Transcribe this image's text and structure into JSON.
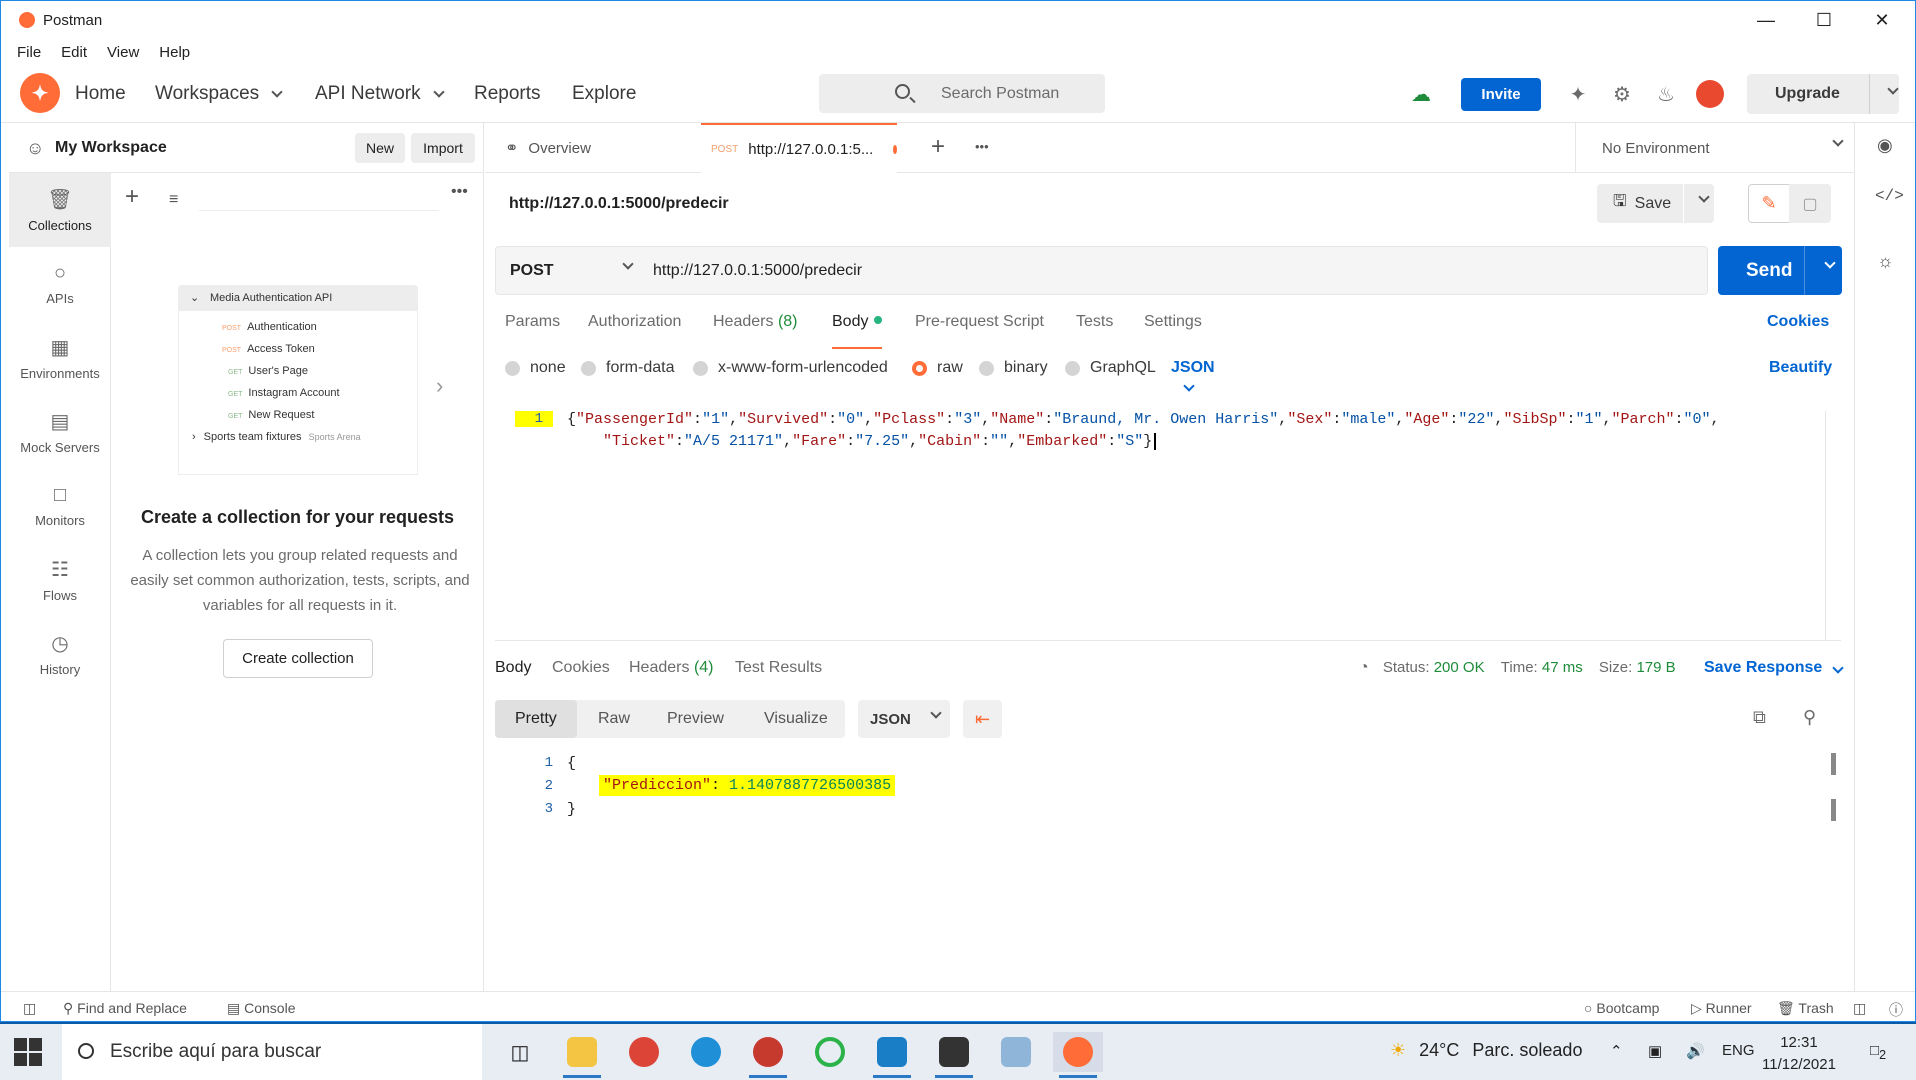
{
  "window": {
    "title": "Postman"
  },
  "menu": [
    "File",
    "Edit",
    "View",
    "Help"
  ],
  "header": {
    "home": "Home",
    "workspaces": "Workspaces",
    "api_network": "API Network",
    "reports": "Reports",
    "explore": "Explore",
    "search_placeholder": "Search Postman",
    "invite": "Invite",
    "upgrade": "Upgrade"
  },
  "workspace": {
    "name": "My Workspace",
    "new": "New",
    "import": "Import"
  },
  "rail": [
    {
      "label": "Collections",
      "icon": "collections-icon"
    },
    {
      "label": "APIs",
      "icon": "apis-icon"
    },
    {
      "label": "Environments",
      "icon": "environments-icon"
    },
    {
      "label": "Mock Servers",
      "icon": "mock-servers-icon"
    },
    {
      "label": "Monitors",
      "icon": "monitors-icon"
    },
    {
      "label": "Flows",
      "icon": "flows-icon"
    },
    {
      "label": "History",
      "icon": "history-icon"
    }
  ],
  "illustration": {
    "collection": "Media Authentication API",
    "items": [
      {
        "method": "POST",
        "name": "Authentication"
      },
      {
        "method": "POST",
        "name": "Access Token"
      },
      {
        "method": "GET",
        "name": "User's Page"
      },
      {
        "method": "GET",
        "name": "Instagram Account"
      },
      {
        "method": "GET",
        "name": "New Request"
      }
    ],
    "folder": "Sports team fixtures",
    "folder_ws": "Sports Arena"
  },
  "empty_state": {
    "title": "Create a collection for your requests",
    "description": "A collection lets you group related requests and easily set common authorization, tests, scripts, and variables for all requests in it.",
    "button": "Create collection"
  },
  "tabs": {
    "overview": "Overview",
    "active_method": "POST",
    "active_url": "http://127.0.0.1:5...",
    "environment": "No Environment"
  },
  "request": {
    "title": "http://127.0.0.1:5000/predecir",
    "save": "Save",
    "method": "POST",
    "url": "http://127.0.0.1:5000/predecir",
    "send": "Send",
    "tabs": {
      "params": "Params",
      "authorization": "Authorization",
      "headers": "Headers",
      "headers_count": "(8)",
      "body": "Body",
      "prerequest": "Pre-request Script",
      "tests": "Tests",
      "settings": "Settings"
    },
    "cookies": "Cookies",
    "beautify": "Beautify",
    "body_options": [
      "none",
      "form-data",
      "x-www-form-urlencoded",
      "raw",
      "binary",
      "GraphQL"
    ],
    "body_format": "JSON",
    "line_number": "1"
  },
  "response": {
    "tabs": {
      "body": "Body",
      "cookies": "Cookies",
      "headers": "Headers",
      "headers_count": "(4)",
      "test_results": "Test Results"
    },
    "status_label": "Status:",
    "status": "200 OK",
    "time_label": "Time:",
    "time": "47 ms",
    "size_label": "Size:",
    "size": "179 B",
    "save_response": "Save Response",
    "views": [
      "Pretty",
      "Raw",
      "Preview",
      "Visualize"
    ],
    "format": "JSON",
    "lines": [
      "1",
      "2",
      "3"
    ],
    "open_brace": "{",
    "key": "\"Prediccion\"",
    "colon": ": ",
    "value": "1.1407887726500385",
    "close_brace": "}"
  },
  "statusbar": {
    "find_replace": "Find and Replace",
    "console": "Console",
    "bootcamp": "Bootcamp",
    "runner": "Runner",
    "trash": "Trash"
  },
  "taskbar": {
    "search_placeholder": "Escribe aquí para buscar",
    "temperature": "24°C",
    "weather": "Parc. soleado",
    "lang": "ENG",
    "time": "12:31",
    "date": "11/12/2021",
    "notifications": "2"
  },
  "colors": {
    "accent": "#ff6c37",
    "primary": "#0265d2",
    "success": "#1e8c3a",
    "highlight": "#ffff00"
  }
}
